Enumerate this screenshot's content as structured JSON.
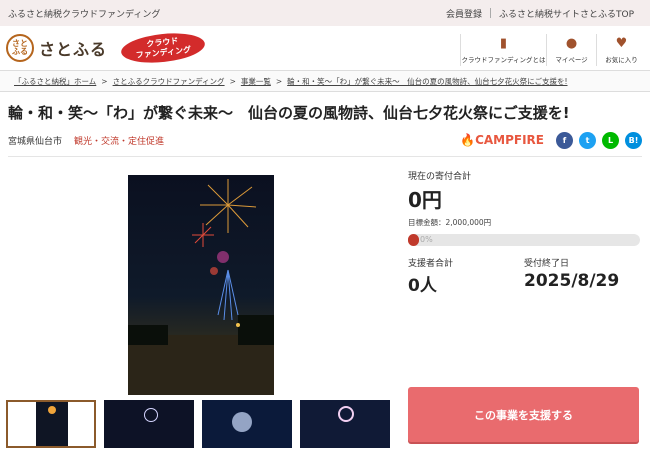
{
  "topbar": {
    "left": "ふるさと納税クラウドファンディング",
    "register": "会員登録",
    "top_link": "ふるさと納税サイトさとふるTOP"
  },
  "header": {
    "logo_mark": "さとふる",
    "logo_text": "さとふる",
    "cf_badge_line1": "クラウド",
    "cf_badge_line2": "ファンディング",
    "nav": [
      {
        "label": "クラウドファンディングとは",
        "icon": "book-icon"
      },
      {
        "label": "マイページ",
        "icon": "user-icon"
      },
      {
        "label": "お気に入り",
        "icon": "heart-icon"
      }
    ]
  },
  "breadcrumb": [
    "「ふるさと納税」ホーム",
    "さとふるクラウドファンディング",
    "事業一覧",
    "輪・和・笑～「わ」が繋ぐ未来～　仙台の夏の風物詩、仙台七夕花火祭にご支援を!"
  ],
  "project": {
    "title": "輪・和・笑～「わ」が繋ぐ未来～　仙台の夏の風物詩、仙台七夕花火祭にご支援を!",
    "city": "宮城県仙台市",
    "category": "観光・交流・定住促進",
    "partner": "CAMPFIRE"
  },
  "share": [
    {
      "name": "facebook",
      "glyph": "f",
      "color": "#3b5998"
    },
    {
      "name": "twitter",
      "glyph": "t",
      "color": "#1da1f2"
    },
    {
      "name": "line",
      "glyph": "L",
      "color": "#00b900"
    },
    {
      "name": "hatena",
      "glyph": "B!",
      "color": "#008fde"
    }
  ],
  "stats": {
    "total_label": "現在の寄付合計",
    "total_value": "0円",
    "goal_text": "目標金額：2,000,000円",
    "progress_text": "0%",
    "progress": 0,
    "supporters_label": "支援者合計",
    "supporters_value": "0人",
    "deadline_label": "受付終了日",
    "deadline_value": "2025/8/29"
  },
  "support_button": "この事業を支援する"
}
